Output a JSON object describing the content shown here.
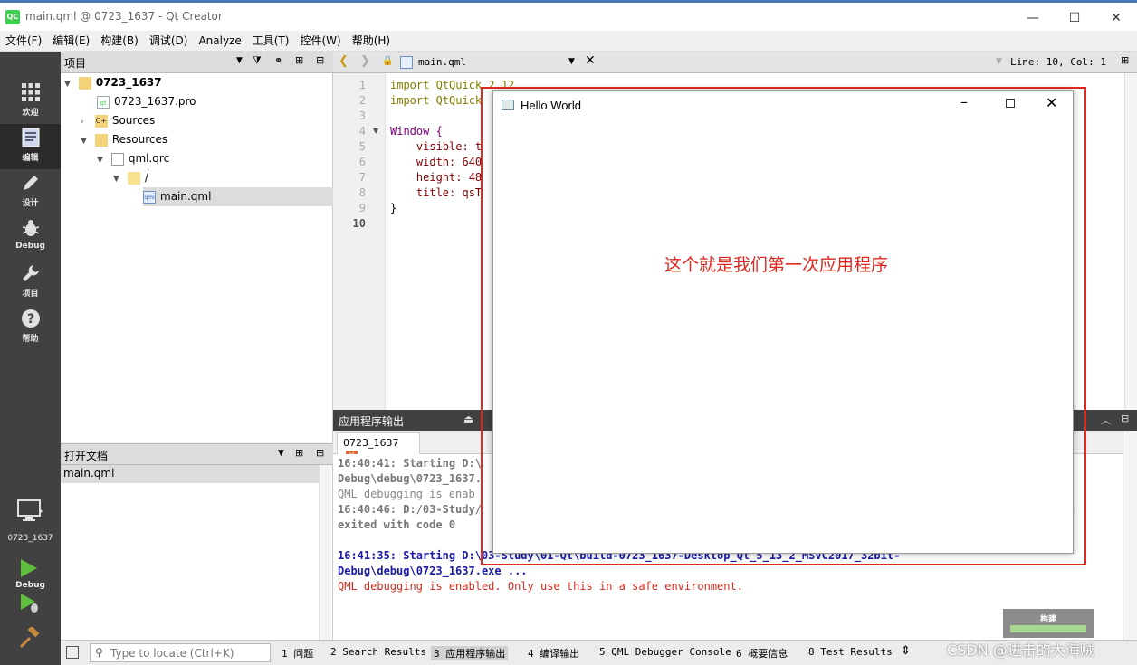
{
  "window": {
    "title": "main.qml @ 0723_1637 - Qt Creator",
    "app_icon_text": "QC",
    "controls": {
      "minimize": "—",
      "maximize": "☐",
      "close": "✕"
    }
  },
  "menu": [
    "文件(F)",
    "编辑(E)",
    "构建(B)",
    "调试(D)",
    "Analyze",
    "工具(T)",
    "控件(W)",
    "帮助(H)"
  ],
  "modes": [
    {
      "label": "欢迎",
      "icon": "grid-icon"
    },
    {
      "label": "编辑",
      "icon": "edit-icon"
    },
    {
      "label": "设计",
      "icon": "pencil-icon"
    },
    {
      "label": "Debug",
      "icon": "bug-icon"
    },
    {
      "label": "项目",
      "icon": "wrench-icon"
    },
    {
      "label": "帮助",
      "icon": "help-icon"
    }
  ],
  "kit": {
    "name": "0723_1637",
    "build": "Debug"
  },
  "project_pane": {
    "title": "项目",
    "tree": [
      {
        "label": "0723_1637",
        "depth": 0,
        "arrow": "▼",
        "bold": true
      },
      {
        "label": "0723_1637.pro",
        "depth": 1,
        "arrow": ""
      },
      {
        "label": "Sources",
        "depth": 1,
        "arrow": "›"
      },
      {
        "label": "Resources",
        "depth": 1,
        "arrow": "▼"
      },
      {
        "label": "qml.qrc",
        "depth": 2,
        "arrow": "▼"
      },
      {
        "label": "/",
        "depth": 3,
        "arrow": "▼"
      },
      {
        "label": "main.qml",
        "depth": 4,
        "arrow": "",
        "selected": true
      }
    ]
  },
  "open_docs": {
    "title": "打开文档",
    "items": [
      "main.qml"
    ]
  },
  "editor": {
    "file": "main.qml",
    "position": "Line: 10, Col: 1",
    "line_numbers": [
      "1",
      "2",
      "3",
      "4",
      "5",
      "6",
      "7",
      "8",
      "9",
      "10"
    ],
    "lines": [
      "import QtQuick 2.12",
      "import QtQuick",
      "",
      "Window {",
      "    visible: t",
      "    width: 640",
      "    height: 48",
      "    title: qsT",
      "}",
      ""
    ]
  },
  "output": {
    "title": "应用程序输出",
    "tab": "0723_1637",
    "lines": [
      {
        "text": "16:40:41: Starting D:\\",
        "style": "gray-bold"
      },
      {
        "text": "Debug\\debug\\0723_1637.",
        "style": "gray-bold"
      },
      {
        "text": "QML debugging is enab",
        "style": "gray"
      },
      {
        "text": "16:40:46: D:/03-Study/",
        "style": "gray-bold"
      },
      {
        "text": "exited with code 0",
        "style": "gray-bold"
      },
      {
        "text": "",
        "style": "gray"
      },
      {
        "text": "16:41:35: Starting D:\\03-Study\\01-Qt\\build-0723_1637-Desktop_Qt_5_13_2_MSVC2017_32bit-",
        "style": "blue-bold"
      },
      {
        "text": "Debug\\debug\\0723_1637.exe ...",
        "style": "blue-bold"
      },
      {
        "text": "QML debugging is enabled. Only use this in a safe environment.",
        "style": "red"
      }
    ],
    "side_glyph": "e"
  },
  "status_bar": {
    "locator_placeholder": "Type to locate (Ctrl+K)",
    "tabs": [
      "1 问题",
      "2 Search Results",
      "3 应用程序输出",
      "4 编译输出",
      "5 QML Debugger Console",
      "6 概要信息",
      "8 Test Results"
    ]
  },
  "build_widget": {
    "label": "构建"
  },
  "hello_window": {
    "title": "Hello World"
  },
  "annotation": "这个就是我们第一次应用程序",
  "watermark": "CSDN @进击的大海贼",
  "colors": {
    "annotation_red": "#e0281f",
    "modebar_bg": "#414141",
    "output_blue": "#1a1aa6"
  }
}
